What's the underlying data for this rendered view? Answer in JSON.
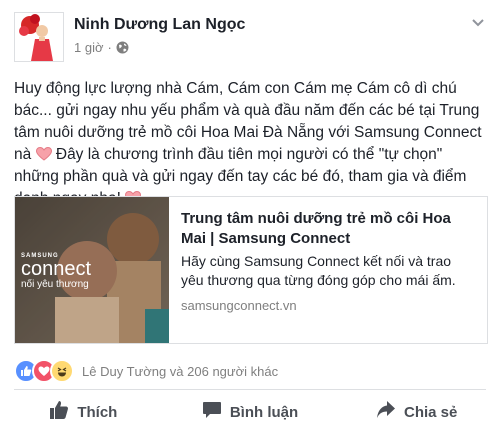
{
  "post": {
    "author": "Ninh Dương Lan Ngọc",
    "time": "1 giờ",
    "separator": "·",
    "text_part1": "Huy động lực lượng nhà Cám, Cám con Cám mẹ Cám cô dì chú bác... gửi ngay nhu yếu phẩm và quà đầu năm đến các bé tại Trung tâm nuôi dưỡng trẻ mồ côi Hoa Mai Đà Nẵng với Samsung Connect nà ",
    "text_part2": " Đây là chương trình đầu tiên mọi người có thể \"tự chọn\" những phần quà và gửi ngay đến tay các bé đó, tham gia và điểm danh ngay nha! "
  },
  "link_card": {
    "title": "Trung tâm nuôi dưỡng trẻ mồ côi Hoa Mai | Samsung Connect",
    "description": "Hãy cùng Samsung Connect kết nối và trao yêu thương qua từng đóng góp cho mái ấm.",
    "domain": "samsungconnect.vn",
    "thumb_brand": "SAMSUNG",
    "thumb_logo": "connect",
    "thumb_tagline": "nối yêu thương"
  },
  "reactions": {
    "text": "Lê Duy Tường và 206 người khác",
    "icons": [
      "like-reaction-icon",
      "love-reaction-icon",
      "haha-reaction-icon"
    ]
  },
  "actions": {
    "like": "Thích",
    "comment": "Bình luận",
    "share": "Chia sẻ"
  },
  "colors": {
    "like_blue": "#5890ff",
    "love_red": "#f25268",
    "haha_yellow": "#ffd972",
    "heart_pink": "#f7a1a9"
  }
}
